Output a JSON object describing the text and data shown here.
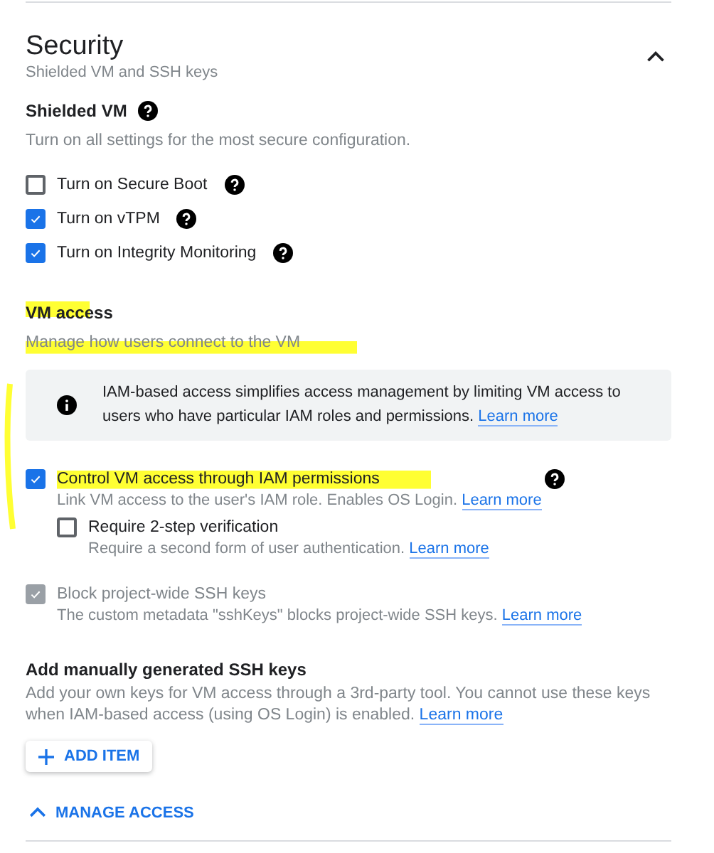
{
  "section": {
    "title": "Security",
    "subtitle": "Shielded VM and SSH keys",
    "expanded": true
  },
  "shielded_vm": {
    "title": "Shielded VM",
    "help": true,
    "description": "Turn on all settings for the most secure configuration.",
    "options": [
      {
        "label": "Turn on Secure Boot",
        "checked": false,
        "help": true
      },
      {
        "label": "Turn on vTPM",
        "checked": true,
        "help": true
      },
      {
        "label": "Turn on Integrity Monitoring",
        "checked": true,
        "help": true
      }
    ]
  },
  "vm_access": {
    "title": "VM access",
    "description": "Manage how users connect to the VM",
    "info": {
      "text": "IAM-based access simplifies access management by limiting VM access to users who have particular IAM roles and permissions.",
      "link": "Learn more"
    },
    "options": [
      {
        "label": "Control VM access through IAM permissions",
        "checked": true,
        "help": true,
        "description": "Link VM access to the user's IAM role. Enables OS Login.",
        "link": "Learn more",
        "children": [
          {
            "label": "Require 2-step verification",
            "checked": false,
            "help": false,
            "description": "Require a second form of user authentication.",
            "link": "Learn more"
          }
        ]
      },
      {
        "label": "Block project-wide SSH keys",
        "checked": true,
        "disabled": true,
        "help": false,
        "description": "The custom metadata \"sshKeys\" blocks project-wide SSH keys.",
        "link": "Learn more"
      }
    ]
  },
  "ssh_keys": {
    "title": "Add manually generated SSH keys",
    "description": "Add your own keys for VM access through a 3rd-party tool. You cannot use these keys when IAM-based access (using OS Login) is enabled.",
    "link": "Learn more",
    "button": "ADD ITEM"
  },
  "manage_access": {
    "label": "MANAGE ACCESS",
    "expanded": true
  }
}
